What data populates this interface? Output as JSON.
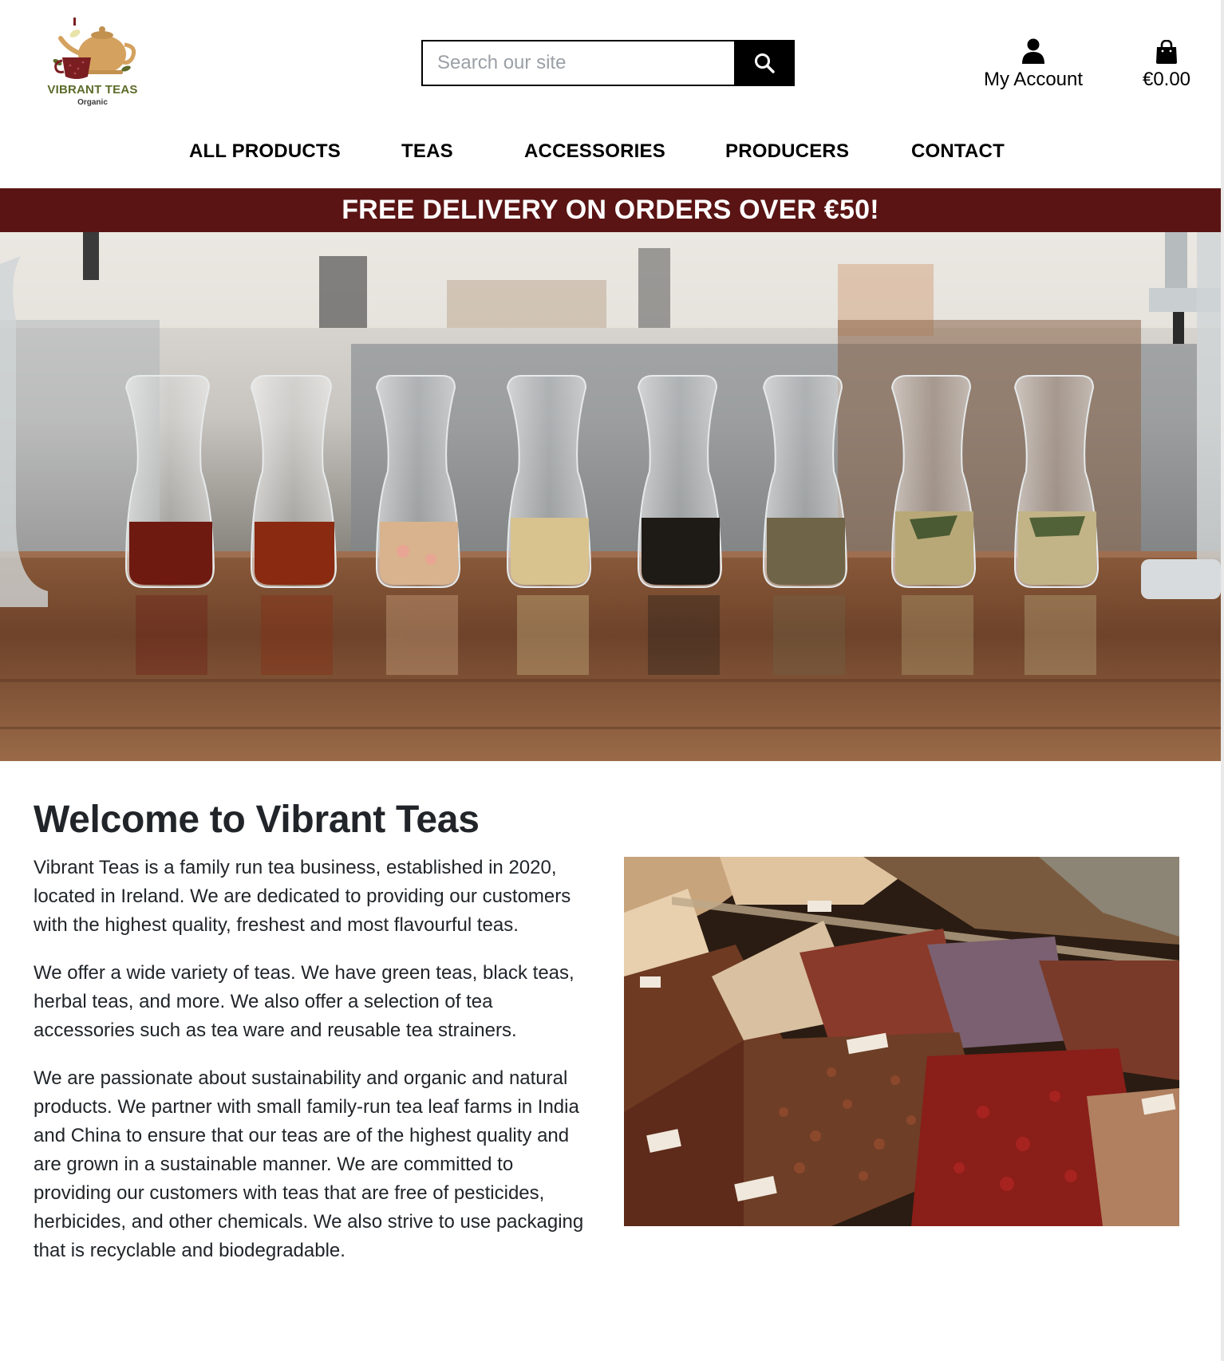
{
  "header": {
    "logo": {
      "brand": "VIBRANT TEAS",
      "tagline": "Organic",
      "icon": "teapot-cup-logo-icon"
    },
    "search": {
      "placeholder": "Search our site",
      "value": "",
      "icon": "search-icon"
    },
    "account": {
      "label": "My Account",
      "icon": "user-icon"
    },
    "cart": {
      "total": "€0.00",
      "icon": "shopping-bag-icon"
    }
  },
  "nav": {
    "items": [
      {
        "label": "ALL PRODUCTS"
      },
      {
        "label": "TEAS"
      },
      {
        "label": "ACCESSORIES"
      },
      {
        "label": "PRODUCERS"
      },
      {
        "label": "CONTACT"
      }
    ]
  },
  "banner": {
    "text": "FREE DELIVERY ON ORDERS OVER €50!",
    "background": "#5a1414",
    "color": "#ffffff"
  },
  "hero": {
    "image": "tea-carafes-on-wooden-bar-photo"
  },
  "welcome": {
    "title": "Welcome to Vibrant Teas",
    "paragraphs": [
      "Vibrant Teas is a family run tea business, established in 2020, located in Ireland. We are dedicated to providing our customers with the highest quality, freshest and most flavourful teas.",
      "We offer a wide variety of teas. We have green teas, black teas, herbal teas, and more. We also offer a selection of tea accessories such as tea ware and reusable tea strainers.",
      "We are passionate about sustainability and organic and natural products. We partner with small family-run tea leaf farms in India and China to ensure that our teas are of the highest quality and are grown in a sustainable manner. We are committed to providing our customers with teas that are free of pesticides, herbicides, and other chemicals. We also strive to use packaging that is recyclable and biodegradable."
    ],
    "image": "loose-tea-market-bins-photo"
  },
  "colors": {
    "banner": "#5a1414",
    "text": "#212529",
    "logo_green": "#5c6b2a",
    "teapot": "#d4a15e"
  }
}
